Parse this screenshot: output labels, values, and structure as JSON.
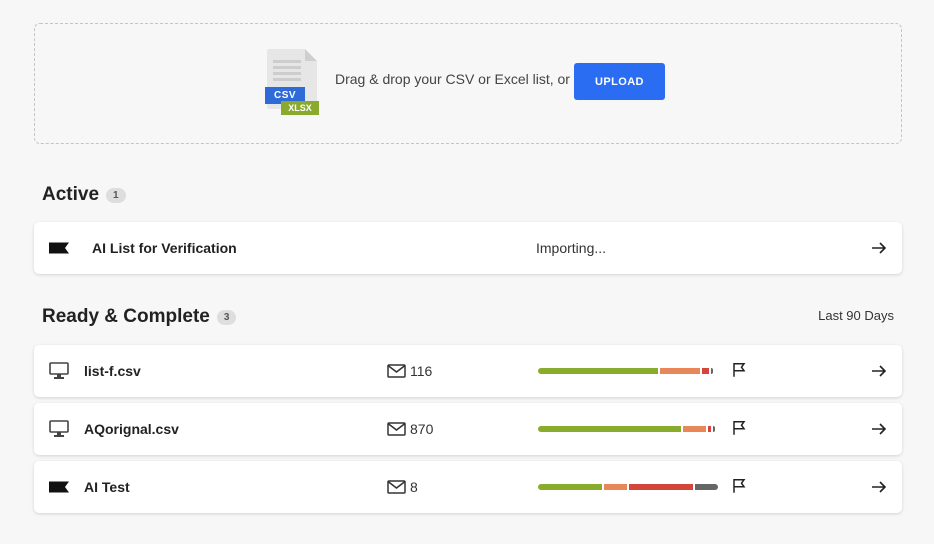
{
  "dropzone": {
    "prompt": "Drag & drop your CSV or Excel list, or",
    "upload_label": "UPLOAD",
    "icon_badge_primary": "CSV",
    "icon_badge_secondary": "XLSX"
  },
  "active": {
    "title": "Active",
    "count": "1",
    "items": [
      {
        "icon": "black-flag-icon",
        "name": "AI List for Verification",
        "status": "Importing..."
      }
    ]
  },
  "ready": {
    "title": "Ready & Complete",
    "count": "3",
    "range_label": "Last 90 Days",
    "items": [
      {
        "icon": "monitor-icon",
        "name": "list-f.csv",
        "emails": "116",
        "breakdown": [
          {
            "status": "valid",
            "share": 0.69,
            "color": "#8aac2c"
          },
          {
            "status": "risky",
            "share": 0.23,
            "color": "#e8875a"
          },
          {
            "status": "invalid",
            "share": 0.04,
            "color": "#d5463a"
          },
          {
            "status": "unknown",
            "share": 0.01,
            "color": "#666666"
          }
        ]
      },
      {
        "icon": "monitor-icon",
        "name": "AQorignal.csv",
        "emails": "870",
        "breakdown": [
          {
            "status": "valid",
            "share": 0.82,
            "color": "#8aac2c"
          },
          {
            "status": "risky",
            "share": 0.13,
            "color": "#e8875a"
          },
          {
            "status": "invalid",
            "share": 0.02,
            "color": "#d5463a"
          },
          {
            "status": "unknown",
            "share": 0.01,
            "color": "#666666"
          }
        ]
      },
      {
        "icon": "black-flag-icon",
        "name": "AI Test",
        "emails": "8",
        "breakdown": [
          {
            "status": "valid",
            "share": 0.37,
            "color": "#8aac2c"
          },
          {
            "status": "risky",
            "share": 0.13,
            "color": "#e8875a"
          },
          {
            "status": "invalid",
            "share": 0.37,
            "color": "#d5463a"
          },
          {
            "status": "unknown",
            "share": 0.13,
            "color": "#666666"
          }
        ]
      }
    ]
  }
}
